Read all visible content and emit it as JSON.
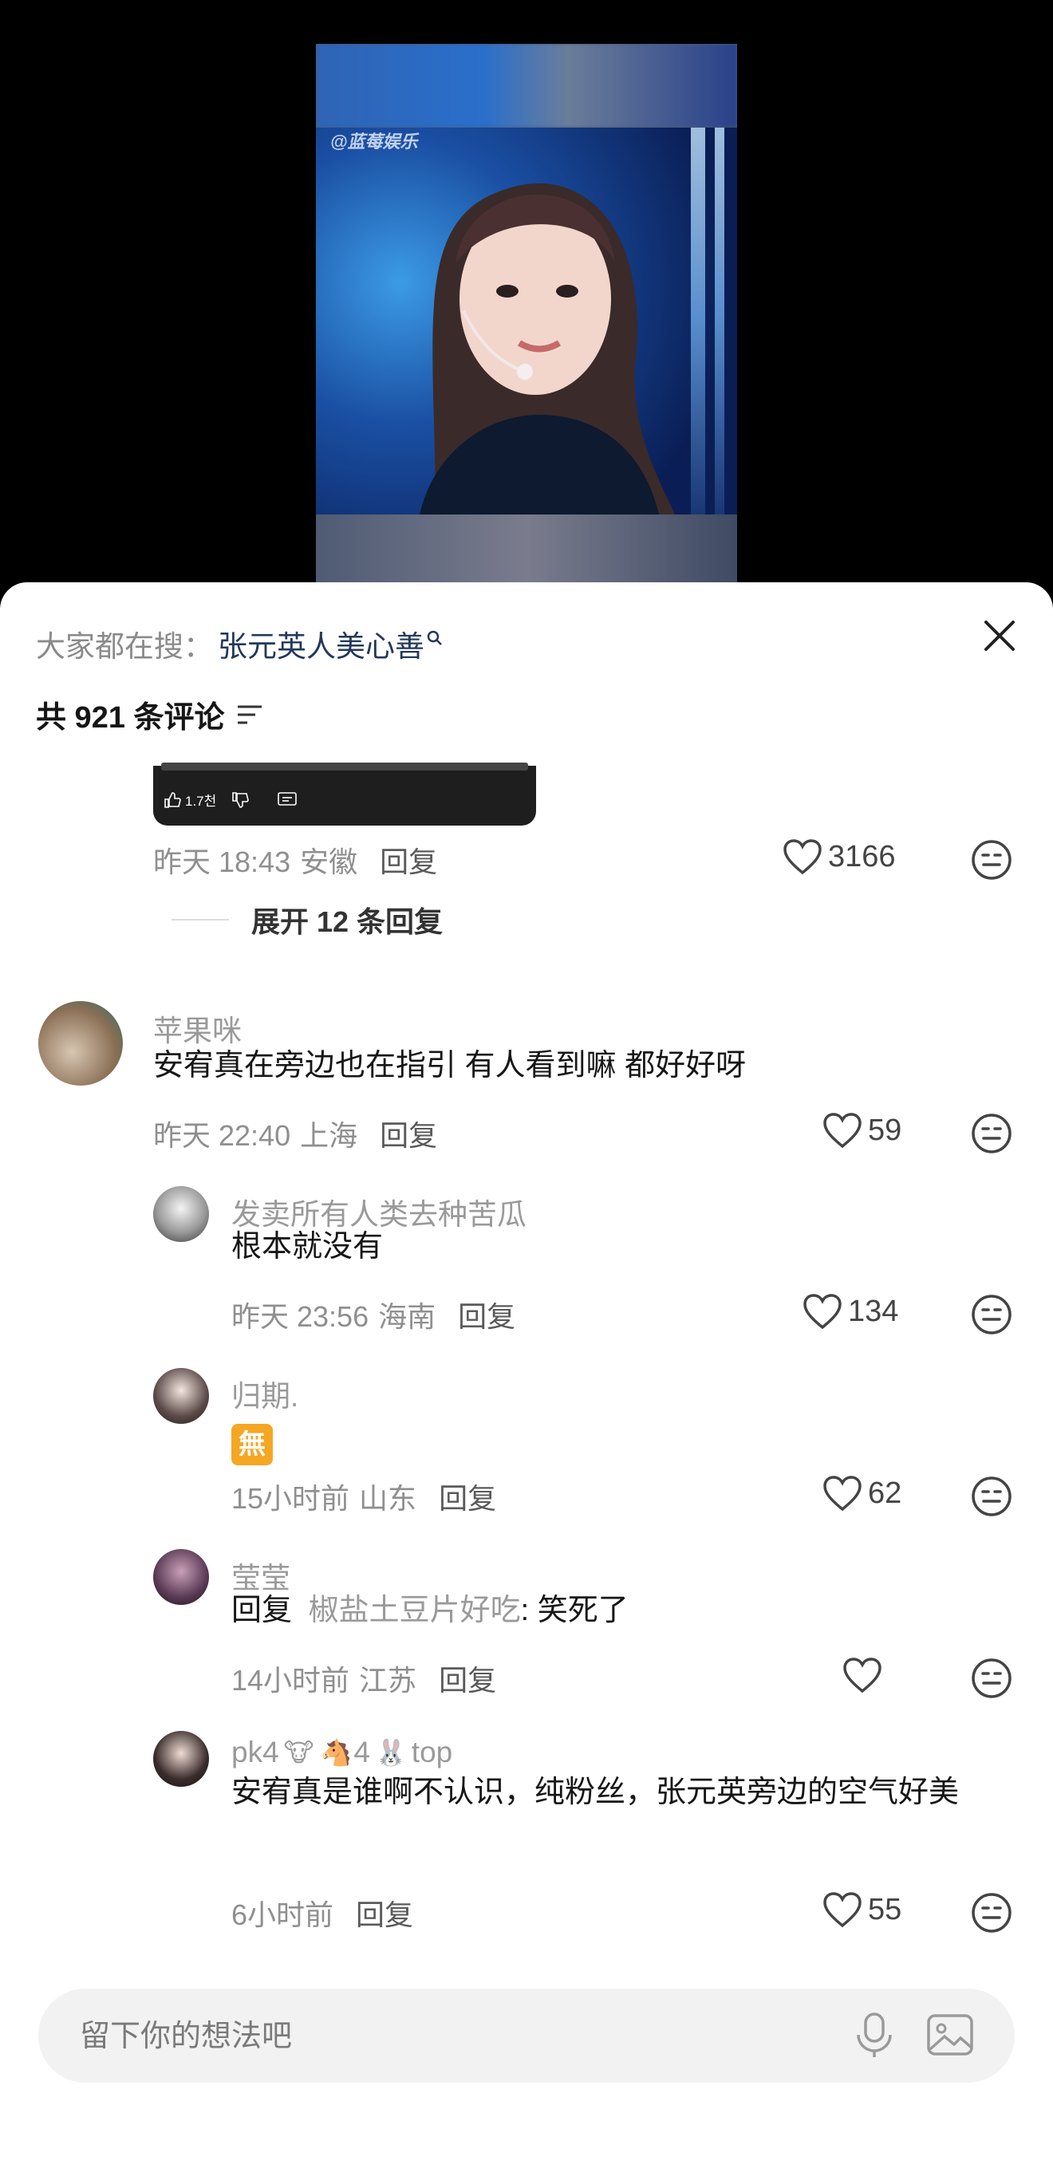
{
  "video": {
    "watermark": "@蓝莓娱乐"
  },
  "header": {
    "trending_prefix": "大家都在搜：",
    "trending_query": "张元英人美心善",
    "comment_count": "共 921 条评论"
  },
  "colors": {
    "link": "#23385b",
    "muted": "#8f8f8f",
    "sheet_bg": "#ffffff",
    "input_bg": "#f2f2f2"
  },
  "top_comment": {
    "screenshot_likes": "1.7천",
    "time": "昨天 18:43",
    "location": "安徽",
    "reply_label": "回复",
    "likes": "3166",
    "expand_label": "展开 12 条回复"
  },
  "comments": [
    {
      "username": "苹果咪",
      "text": "安宥真在旁边也在指引 有人看到嘛 都好好呀",
      "time": "昨天 22:40",
      "location": "上海",
      "reply_label": "回复",
      "likes": "59"
    }
  ],
  "replies": [
    {
      "username": "发卖所有人类去种苦瓜",
      "text": "根本就没有",
      "time": "昨天 23:56",
      "location": "海南",
      "reply_label": "回复",
      "likes": "134"
    },
    {
      "username": "归期.",
      "emoji": "無",
      "time": "15小时前",
      "location": "山东",
      "reply_label": "回复",
      "likes": "62"
    },
    {
      "username": "莹莹",
      "reply_prefix": "回复",
      "reply_to": "椒盐土豆片好吃",
      "text": ": 笑死了",
      "time": "14小时前",
      "location": "江苏",
      "reply_label": "回复",
      "likes": ""
    },
    {
      "username": "pk4",
      "badge_num": "4",
      "badge_text": "top",
      "text": "安宥真是谁啊不认识，纯粉丝，张元英旁边的空气好美",
      "time": "6小时前",
      "reply_label": "回复",
      "likes": "55"
    }
  ],
  "input": {
    "placeholder": "留下你的想法吧"
  }
}
